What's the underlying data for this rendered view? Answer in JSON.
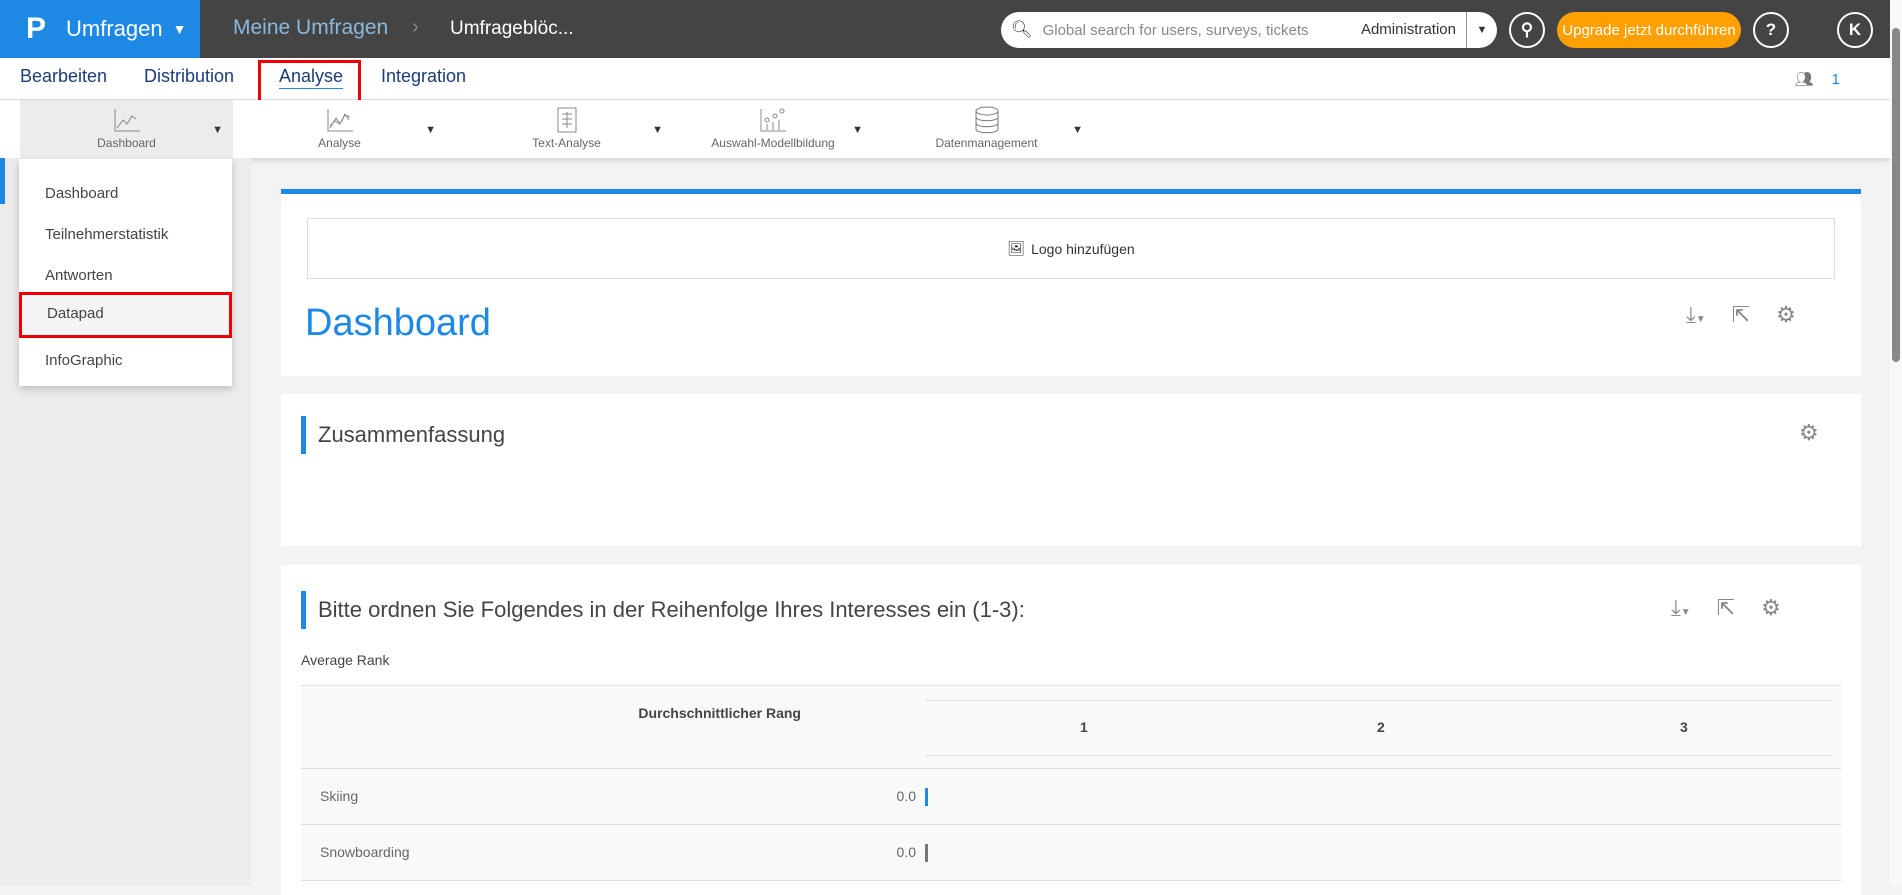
{
  "header": {
    "logo": "P",
    "app": "Umfragen",
    "breadcrumb_root": "Meine Umfragen",
    "breadcrumb_current": "Umfrageblöc...",
    "search_placeholder": "Global search for users, surveys, tickets",
    "search_scope": "Administration",
    "upgrade": "Upgrade jetzt durchführen",
    "help": "?",
    "avatar": "K"
  },
  "tabs": [
    "Bearbeiten",
    "Distribution",
    "Analyse",
    "Integration"
  ],
  "users_count": "1",
  "toolbar": [
    "Dashboard",
    "Analyse",
    "Text-Analyse",
    "Auswahl-Modellbildung",
    "Datenmanagement"
  ],
  "menu": [
    "Dashboard",
    "Teilnehmerstatistik",
    "Antworten",
    "Datapad",
    "InfoGraphic"
  ],
  "main": {
    "logo_add": "Logo hinzufügen",
    "title": "Dashboard",
    "summary": "Zusammenfassung",
    "question": "Bitte ordnen Sie Folgendes in der Reihenfolge Ihres Interesses ein (1-3):",
    "avg_rank": "Average Rank",
    "table": {
      "col": "Durchschnittlicher Rang",
      "ranks": [
        "1",
        "2",
        "3"
      ],
      "rows": [
        {
          "label": "Skiing",
          "value": "0.0",
          "color": "#1e88e5"
        },
        {
          "label": "Snowboarding",
          "value": "0.0",
          "color": "#777777"
        }
      ]
    }
  }
}
